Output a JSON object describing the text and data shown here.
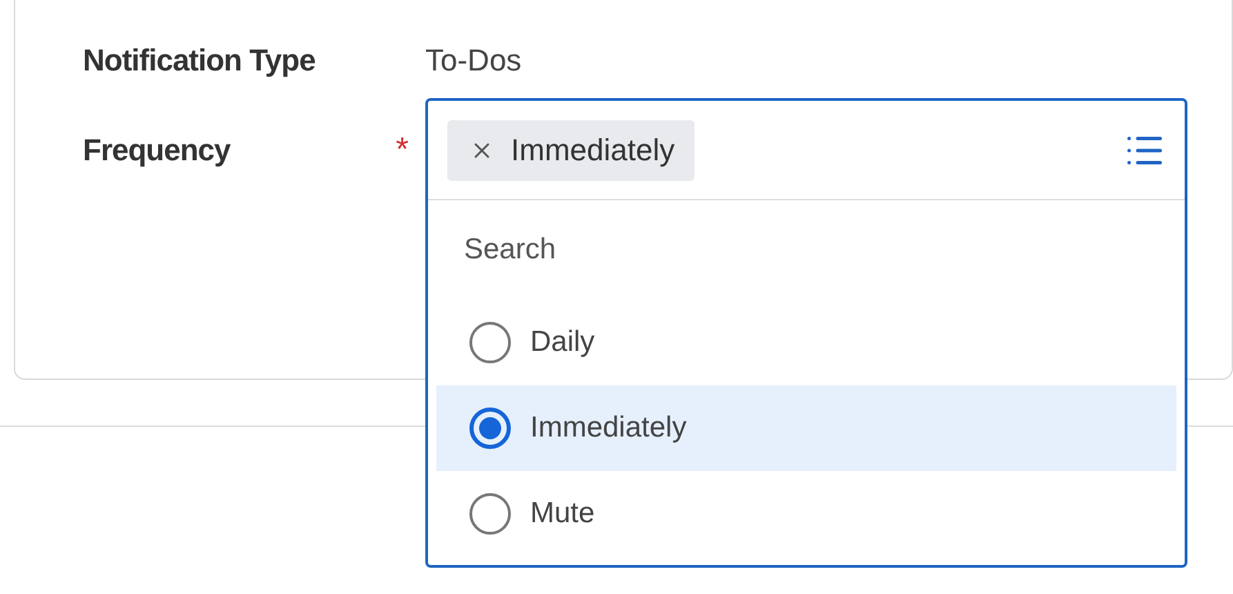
{
  "fields": [
    {
      "kind": "text",
      "label": "Notification Type",
      "value": "To-Dos"
    },
    {
      "kind": "select",
      "label": "Frequency",
      "required": true,
      "required_mark": "*",
      "chip": "Immediately",
      "search": {
        "placeholder": "Search"
      },
      "options": [
        {
          "label": "Daily",
          "selected": false
        },
        {
          "label": "Immediately",
          "selected": true
        },
        {
          "label": "Mute",
          "selected": false
        }
      ]
    }
  ]
}
